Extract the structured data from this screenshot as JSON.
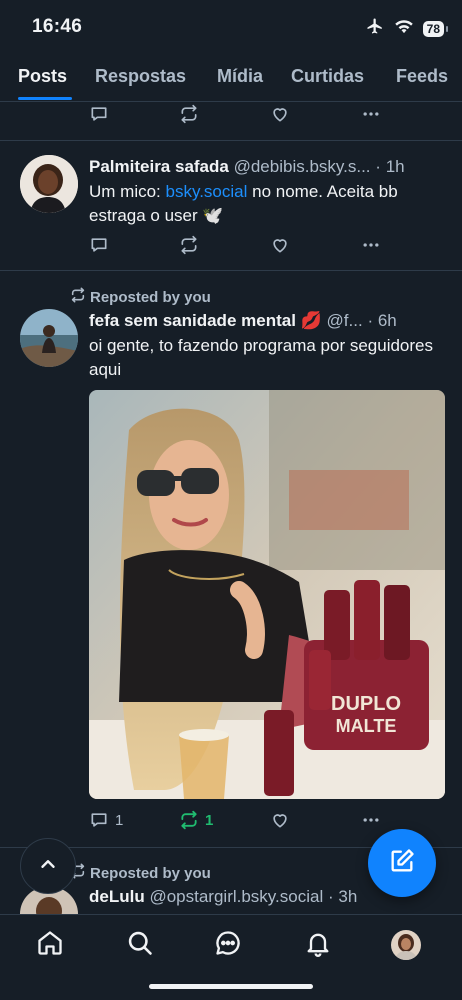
{
  "status_bar": {
    "time": "16:46",
    "battery": "78"
  },
  "tabs": [
    {
      "label": "Posts",
      "active": true
    },
    {
      "label": "Respostas"
    },
    {
      "label": "Mídia"
    },
    {
      "label": "Curtidas"
    },
    {
      "label": "Feeds"
    }
  ],
  "posts": [
    {
      "author": "Palmiteira safada",
      "handle": "@debibis.bsky.s...",
      "time": "1h",
      "text_before": "Um mico: ",
      "link": "bsky.social",
      "text_after": " no nome. Aceita bb estraga o user 🕊️"
    },
    {
      "repost_label": "Reposted by you",
      "author": "fefa sem sanidade mental 💋",
      "handle": "@f...",
      "time": "6h",
      "text": "oi gente, to fazendo programa por seguidores aqui",
      "replies": "1",
      "reposts": "1"
    },
    {
      "repost_label": "Reposted by you",
      "author": "deLulu",
      "handle": "@opstargirl.bsky.social",
      "time": "3h"
    }
  ],
  "colors": {
    "background": "#161e27",
    "accent": "#1083fe",
    "repost_active": "#20bc70",
    "muted": "#aebbc9"
  }
}
